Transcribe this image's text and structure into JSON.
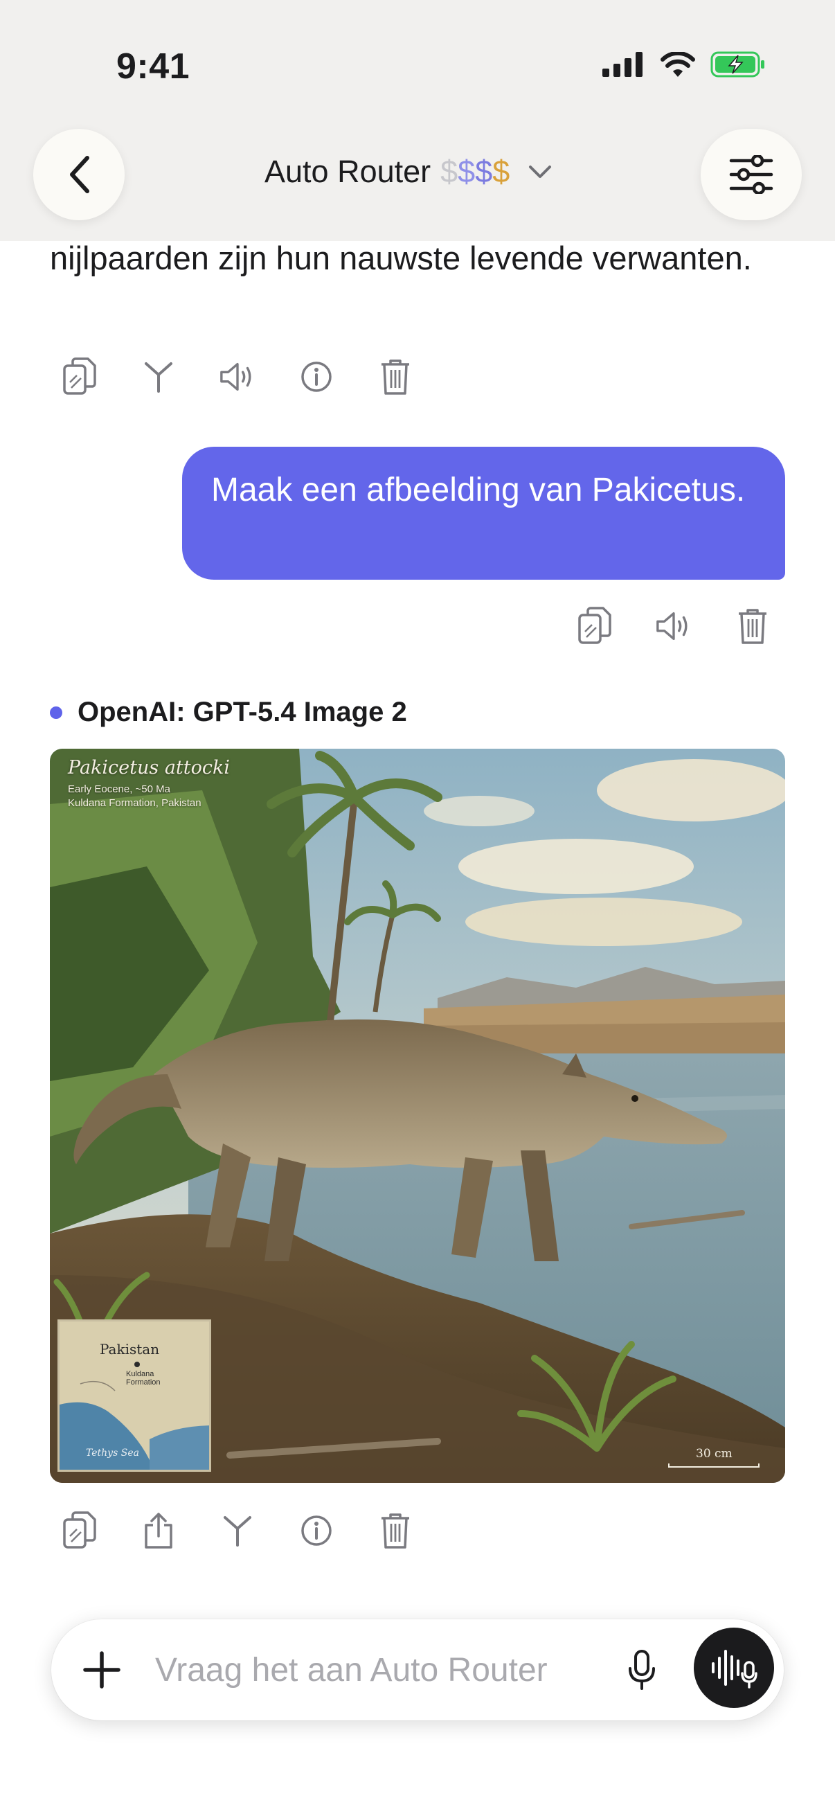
{
  "status_bar": {
    "time": "9:41"
  },
  "header": {
    "title": "Auto Router",
    "price_symbols": [
      "$",
      "$",
      "$",
      "$"
    ],
    "price_colors": [
      "#c7c7cc",
      "#8f90e8",
      "#7b7be0",
      "#d9a13a"
    ]
  },
  "conversation": {
    "previous_reply_text": "nijlpaarden zijn hun nauwste levende verwanten.",
    "previous_reply_actions": [
      "copy-icon",
      "branch-icon",
      "speaker-icon",
      "info-icon",
      "trash-icon"
    ],
    "user_message": "Maak een afbeelding van Pakicetus.",
    "user_message_actions": [
      "copy-icon",
      "speaker-icon",
      "trash-icon"
    ],
    "assistant_model": "OpenAI: GPT-5.4 Image 2",
    "image": {
      "title": "Pakicetus attocki",
      "subtitle_1": "Early Eocene, ~50 Ma",
      "subtitle_2": "Kuldana Formation, Pakistan",
      "map_title": "Pakistan",
      "map_location": "Kuldana Formation",
      "map_sea": "Tethys Sea",
      "scale_label": "30 cm"
    },
    "assistant_actions": [
      "copy-icon",
      "share-icon",
      "branch-icon",
      "info-icon",
      "trash-icon"
    ]
  },
  "composer": {
    "placeholder": "Vraag het aan Auto Router"
  },
  "colors": {
    "accent": "#6366ea",
    "top_bar": "#f1f0ee",
    "icon_gray": "#8e8e93"
  }
}
